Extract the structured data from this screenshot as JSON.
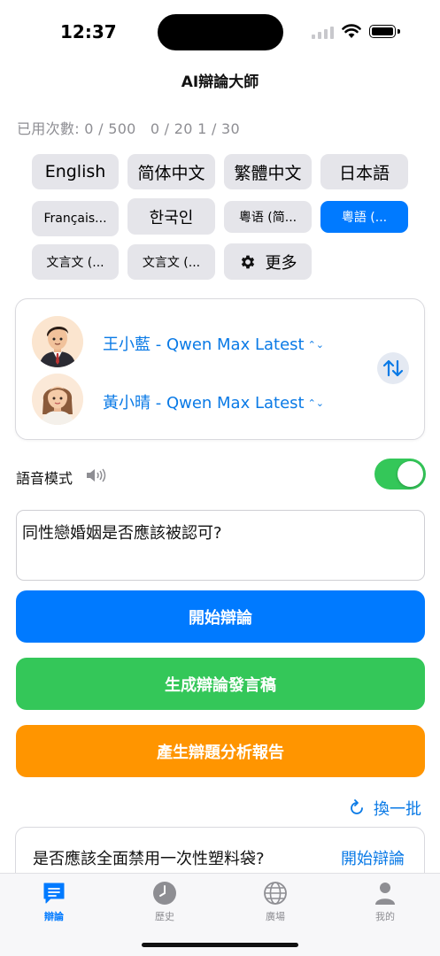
{
  "status_bar": {
    "time": "12:37"
  },
  "app": {
    "title": "AI辯論大師"
  },
  "usage": {
    "text": "已用次數: 0 / 500   0 / 20 1 / 30"
  },
  "languages": [
    {
      "label": "English",
      "selected": false
    },
    {
      "label": "简体中文",
      "selected": false
    },
    {
      "label": "繁體中文",
      "selected": false
    },
    {
      "label": "日本語",
      "selected": false
    },
    {
      "label": "Français...",
      "selected": false
    },
    {
      "label": "한국인",
      "selected": false
    },
    {
      "label": "粵语 (简...",
      "selected": false
    },
    {
      "label": "粵語 (...",
      "selected": true
    },
    {
      "label": "文言文 (...",
      "selected": false
    },
    {
      "label": "文言文 (...",
      "selected": false
    },
    {
      "label": "更多",
      "selected": false,
      "icon": "gear-icon"
    }
  ],
  "debaters": [
    {
      "name": "王小藍 - Qwen Max Latest",
      "avatar": "male-avatar"
    },
    {
      "name": "黃小晴 - Qwen Max Latest",
      "avatar": "female-avatar"
    }
  ],
  "voice_mode": {
    "label": "語音模式",
    "enabled": true
  },
  "topic": {
    "value": "同性戀婚姻是否應該被認可?"
  },
  "actions": {
    "start": "開始辯論",
    "speech": "生成辯論發言稿",
    "report": "產生辯題分析報告"
  },
  "refresh": {
    "label": "換一批"
  },
  "suggestion": {
    "topic": "是否應該全面禁用一次性塑料袋?",
    "action": "開始辯論"
  },
  "tabs": [
    {
      "label": "辯論",
      "icon": "chat-icon",
      "active": true
    },
    {
      "label": "歷史",
      "icon": "clock-icon",
      "active": false
    },
    {
      "label": "廣場",
      "icon": "globe-icon",
      "active": false
    },
    {
      "label": "我的",
      "icon": "person-icon",
      "active": false
    }
  ],
  "colors": {
    "accent": "#007aff",
    "green": "#34c759",
    "orange": "#ff9500",
    "chip": "#e5e5ea"
  }
}
